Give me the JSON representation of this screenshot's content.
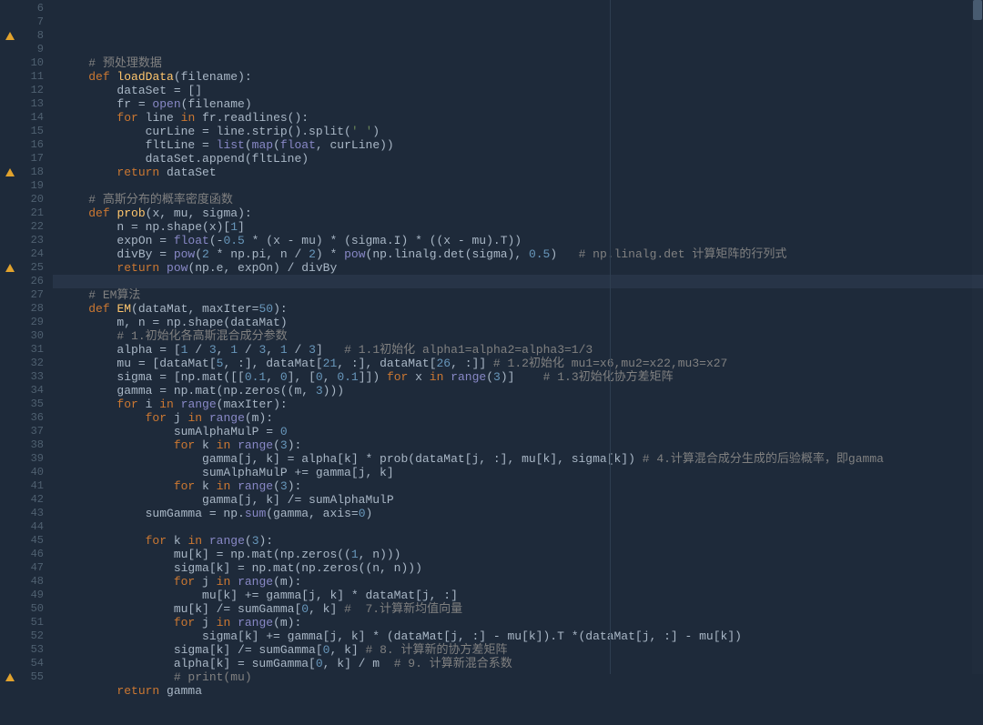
{
  "lines": [
    {
      "n": 6,
      "warn": false,
      "tokens": []
    },
    {
      "n": 7,
      "warn": false,
      "tokens": [
        [
          "    ",
          ""
        ],
        [
          "# 预处理数据",
          "cm"
        ]
      ]
    },
    {
      "n": 8,
      "warn": true,
      "tokens": [
        [
          "    ",
          ""
        ],
        [
          "def ",
          "kw"
        ],
        [
          "loadData",
          "fn"
        ],
        [
          "(filename):",
          ""
        ]
      ]
    },
    {
      "n": 9,
      "warn": false,
      "tokens": [
        [
          "        dataSet = []",
          ""
        ]
      ]
    },
    {
      "n": 10,
      "warn": false,
      "tokens": [
        [
          "        fr = ",
          ""
        ],
        [
          "open",
          "bi"
        ],
        [
          "(filename)",
          ""
        ]
      ]
    },
    {
      "n": 11,
      "warn": false,
      "tokens": [
        [
          "        ",
          ""
        ],
        [
          "for ",
          "kw"
        ],
        [
          "line ",
          ""
        ],
        [
          "in ",
          "kw"
        ],
        [
          "fr.readlines():",
          ""
        ]
      ]
    },
    {
      "n": 12,
      "warn": false,
      "tokens": [
        [
          "            curLine = line.strip().split(",
          ""
        ],
        [
          "' '",
          "str"
        ],
        [
          ")",
          ""
        ]
      ]
    },
    {
      "n": 13,
      "warn": false,
      "tokens": [
        [
          "            fltLine = ",
          ""
        ],
        [
          "list",
          "bi"
        ],
        [
          "(",
          ""
        ],
        [
          "map",
          "bi"
        ],
        [
          "(",
          ""
        ],
        [
          "float",
          "bi"
        ],
        [
          ", curLine))",
          ""
        ]
      ]
    },
    {
      "n": 14,
      "warn": false,
      "tokens": [
        [
          "            dataSet.append(fltLine)",
          ""
        ]
      ]
    },
    {
      "n": 15,
      "warn": false,
      "tokens": [
        [
          "        ",
          ""
        ],
        [
          "return ",
          "kw"
        ],
        [
          "dataSet",
          ""
        ]
      ]
    },
    {
      "n": 16,
      "warn": false,
      "tokens": []
    },
    {
      "n": 17,
      "warn": false,
      "tokens": [
        [
          "    ",
          ""
        ],
        [
          "# 高斯分布的概率密度函数",
          "cm"
        ]
      ]
    },
    {
      "n": 18,
      "warn": true,
      "tokens": [
        [
          "    ",
          ""
        ],
        [
          "def ",
          "kw"
        ],
        [
          "prob",
          "fn"
        ],
        [
          "(x, mu, sigma):",
          ""
        ]
      ]
    },
    {
      "n": 19,
      "warn": false,
      "tokens": [
        [
          "        n = np.shape(x)[",
          ""
        ],
        [
          "1",
          "num"
        ],
        [
          "]",
          ""
        ]
      ]
    },
    {
      "n": 20,
      "warn": false,
      "tokens": [
        [
          "        expOn = ",
          ""
        ],
        [
          "float",
          "bi"
        ],
        [
          "(-",
          ""
        ],
        [
          "0.5",
          "num"
        ],
        [
          " * (x - mu) * (sigma.I) * ((x - mu).T))",
          ""
        ]
      ]
    },
    {
      "n": 21,
      "warn": false,
      "tokens": [
        [
          "        divBy = ",
          ""
        ],
        [
          "pow",
          "bi"
        ],
        [
          "(",
          ""
        ],
        [
          "2",
          "num"
        ],
        [
          " * np.pi, n / ",
          ""
        ],
        [
          "2",
          "num"
        ],
        [
          ") * ",
          ""
        ],
        [
          "pow",
          "bi"
        ],
        [
          "(np.linalg.det(sigma), ",
          ""
        ],
        [
          "0.5",
          "num"
        ],
        [
          ")   ",
          ""
        ],
        [
          "# np.linalg.det 计算矩阵的行列式",
          "cm"
        ]
      ]
    },
    {
      "n": 22,
      "warn": false,
      "tokens": [
        [
          "        ",
          ""
        ],
        [
          "return ",
          "kw"
        ],
        [
          "pow",
          "bi"
        ],
        [
          "(np.e, expOn) / divBy",
          ""
        ]
      ]
    },
    {
      "n": 23,
      "warn": false,
      "current": true,
      "tokens": []
    },
    {
      "n": 24,
      "warn": false,
      "tokens": [
        [
          "    ",
          ""
        ],
        [
          "# EM算法",
          "cm"
        ]
      ]
    },
    {
      "n": 25,
      "warn": true,
      "tokens": [
        [
          "    ",
          ""
        ],
        [
          "def ",
          "kw"
        ],
        [
          "EM",
          "fn"
        ],
        [
          "(dataMat, maxIter=",
          ""
        ],
        [
          "50",
          "num"
        ],
        [
          "):",
          ""
        ]
      ]
    },
    {
      "n": 26,
      "warn": false,
      "tokens": [
        [
          "        m, n = np.shape(dataMat)",
          ""
        ]
      ]
    },
    {
      "n": 27,
      "warn": false,
      "tokens": [
        [
          "        ",
          ""
        ],
        [
          "# 1.初始化各高斯混合成分参数",
          "cm"
        ]
      ]
    },
    {
      "n": 28,
      "warn": false,
      "tokens": [
        [
          "        alpha = [",
          ""
        ],
        [
          "1",
          "num"
        ],
        [
          " / ",
          ""
        ],
        [
          "3",
          "num"
        ],
        [
          ", ",
          ""
        ],
        [
          "1",
          "num"
        ],
        [
          " / ",
          ""
        ],
        [
          "3",
          "num"
        ],
        [
          ", ",
          ""
        ],
        [
          "1",
          "num"
        ],
        [
          " / ",
          ""
        ],
        [
          "3",
          "num"
        ],
        [
          "]   ",
          ""
        ],
        [
          "# 1.1初始化 alpha1=alpha2=alpha3=1/3",
          "cm"
        ]
      ]
    },
    {
      "n": 29,
      "warn": false,
      "tokens": [
        [
          "        mu = [dataMat[",
          ""
        ],
        [
          "5",
          "num"
        ],
        [
          ", :], dataMat[",
          ""
        ],
        [
          "21",
          "num"
        ],
        [
          ", :], dataMat[",
          ""
        ],
        [
          "26",
          "num"
        ],
        [
          ", :]] ",
          ""
        ],
        [
          "# 1.2初始化 mu1=x6,mu2=x22,mu3=x27",
          "cm"
        ]
      ]
    },
    {
      "n": 30,
      "warn": false,
      "tokens": [
        [
          "        sigma = [np.mat([[",
          ""
        ],
        [
          "0.1",
          "num"
        ],
        [
          ", ",
          ""
        ],
        [
          "0",
          "num"
        ],
        [
          "], [",
          ""
        ],
        [
          "0",
          "num"
        ],
        [
          ", ",
          ""
        ],
        [
          "0.1",
          "num"
        ],
        [
          "]]) ",
          ""
        ],
        [
          "for ",
          "kw"
        ],
        [
          "x ",
          ""
        ],
        [
          "in ",
          "kw"
        ],
        [
          "range",
          "bi"
        ],
        [
          "(",
          ""
        ],
        [
          "3",
          "num"
        ],
        [
          ")]    ",
          ""
        ],
        [
          "# 1.3初始化协方差矩阵",
          "cm"
        ]
      ]
    },
    {
      "n": 31,
      "warn": false,
      "tokens": [
        [
          "        gamma = np.mat(np.zeros((m, ",
          ""
        ],
        [
          "3",
          "num"
        ],
        [
          ")))",
          ""
        ]
      ]
    },
    {
      "n": 32,
      "warn": false,
      "tokens": [
        [
          "        ",
          ""
        ],
        [
          "for ",
          "kw"
        ],
        [
          "i ",
          ""
        ],
        [
          "in ",
          "kw"
        ],
        [
          "range",
          "bi"
        ],
        [
          "(maxIter):",
          ""
        ]
      ]
    },
    {
      "n": 33,
      "warn": false,
      "tokens": [
        [
          "            ",
          ""
        ],
        [
          "for ",
          "kw"
        ],
        [
          "j ",
          ""
        ],
        [
          "in ",
          "kw"
        ],
        [
          "range",
          "bi"
        ],
        [
          "(m):",
          ""
        ]
      ]
    },
    {
      "n": 34,
      "warn": false,
      "tokens": [
        [
          "                sumAlphaMulP = ",
          ""
        ],
        [
          "0",
          "num"
        ]
      ]
    },
    {
      "n": 35,
      "warn": false,
      "tokens": [
        [
          "                ",
          ""
        ],
        [
          "for ",
          "kw"
        ],
        [
          "k ",
          ""
        ],
        [
          "in ",
          "kw"
        ],
        [
          "range",
          "bi"
        ],
        [
          "(",
          ""
        ],
        [
          "3",
          "num"
        ],
        [
          "):",
          ""
        ]
      ]
    },
    {
      "n": 36,
      "warn": false,
      "tokens": [
        [
          "                    gamma[j, k] = alpha[k] * prob(dataMat[j, :], mu[k], sigma[k]) ",
          ""
        ],
        [
          "# 4.计算混合成分生成的后验概率，即gamma",
          "cm"
        ]
      ]
    },
    {
      "n": 37,
      "warn": false,
      "tokens": [
        [
          "                    sumAlphaMulP += gamma[j, k]",
          ""
        ]
      ]
    },
    {
      "n": 38,
      "warn": false,
      "tokens": [
        [
          "                ",
          ""
        ],
        [
          "for ",
          "kw"
        ],
        [
          "k ",
          ""
        ],
        [
          "in ",
          "kw"
        ],
        [
          "range",
          "bi"
        ],
        [
          "(",
          ""
        ],
        [
          "3",
          "num"
        ],
        [
          "):",
          ""
        ]
      ]
    },
    {
      "n": 39,
      "warn": false,
      "tokens": [
        [
          "                    gamma[j, k] /= sumAlphaMulP",
          ""
        ]
      ]
    },
    {
      "n": 40,
      "warn": false,
      "tokens": [
        [
          "            sumGamma = np.",
          ""
        ],
        [
          "sum",
          "bi"
        ],
        [
          "(gamma, ",
          ""
        ],
        [
          "axis",
          "param"
        ],
        [
          "=",
          ""
        ],
        [
          "0",
          "num"
        ],
        [
          ")",
          ""
        ]
      ]
    },
    {
      "n": 41,
      "warn": false,
      "tokens": []
    },
    {
      "n": 42,
      "warn": false,
      "tokens": [
        [
          "            ",
          ""
        ],
        [
          "for ",
          "kw"
        ],
        [
          "k ",
          ""
        ],
        [
          "in ",
          "kw"
        ],
        [
          "range",
          "bi"
        ],
        [
          "(",
          ""
        ],
        [
          "3",
          "num"
        ],
        [
          "):",
          ""
        ]
      ]
    },
    {
      "n": 43,
      "warn": false,
      "tokens": [
        [
          "                mu[k] = np.mat(np.zeros((",
          ""
        ],
        [
          "1",
          "num"
        ],
        [
          ", n)))",
          ""
        ]
      ]
    },
    {
      "n": 44,
      "warn": false,
      "tokens": [
        [
          "                sigma[k] = np.mat(np.zeros((n, n)))",
          ""
        ]
      ]
    },
    {
      "n": 45,
      "warn": false,
      "tokens": [
        [
          "                ",
          ""
        ],
        [
          "for ",
          "kw"
        ],
        [
          "j ",
          ""
        ],
        [
          "in ",
          "kw"
        ],
        [
          "range",
          "bi"
        ],
        [
          "(m):",
          ""
        ]
      ]
    },
    {
      "n": 46,
      "warn": false,
      "tokens": [
        [
          "                    mu[k] += gamma[j, k] * dataMat[j, :]",
          ""
        ]
      ]
    },
    {
      "n": 47,
      "warn": false,
      "tokens": [
        [
          "                mu[k] /= sumGamma[",
          ""
        ],
        [
          "0",
          "num"
        ],
        [
          ", k] ",
          ""
        ],
        [
          "#  7.计算新均值向量",
          "cm"
        ]
      ]
    },
    {
      "n": 48,
      "warn": false,
      "tokens": [
        [
          "                ",
          ""
        ],
        [
          "for ",
          "kw"
        ],
        [
          "j ",
          ""
        ],
        [
          "in ",
          "kw"
        ],
        [
          "range",
          "bi"
        ],
        [
          "(m):",
          ""
        ]
      ]
    },
    {
      "n": 49,
      "warn": false,
      "tokens": [
        [
          "                    sigma[k] += gamma[j, k] * (dataMat[j, :] - mu[k]).T *(dataMat[j, :] - mu[k])",
          ""
        ]
      ]
    },
    {
      "n": 50,
      "warn": false,
      "tokens": [
        [
          "                sigma[k] /= sumGamma[",
          ""
        ],
        [
          "0",
          "num"
        ],
        [
          ", k] ",
          ""
        ],
        [
          "# 8. 计算新的协方差矩阵",
          "cm"
        ]
      ]
    },
    {
      "n": 51,
      "warn": false,
      "tokens": [
        [
          "                alpha[k] = sumGamma[",
          ""
        ],
        [
          "0",
          "num"
        ],
        [
          ", k] / m  ",
          ""
        ],
        [
          "# 9. 计算新混合系数",
          "cm"
        ]
      ]
    },
    {
      "n": 52,
      "warn": false,
      "tokens": [
        [
          "                ",
          ""
        ],
        [
          "# print(mu)",
          "cm"
        ]
      ]
    },
    {
      "n": 53,
      "warn": false,
      "tokens": [
        [
          "        ",
          ""
        ],
        [
          "return ",
          "kw"
        ],
        [
          "gamma",
          ""
        ]
      ]
    },
    {
      "n": 54,
      "warn": false,
      "tokens": []
    },
    {
      "n": 55,
      "warn": true,
      "tokens": []
    }
  ]
}
